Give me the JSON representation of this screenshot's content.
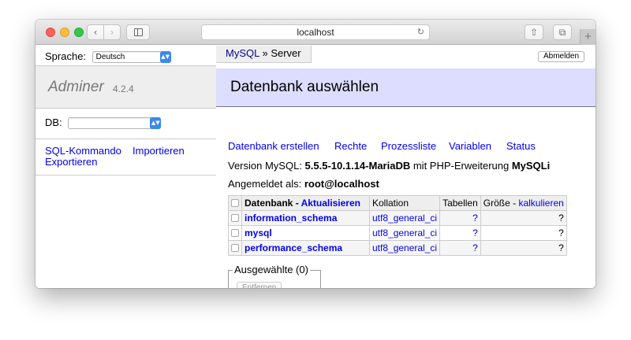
{
  "browser": {
    "address": "localhost",
    "back_glyph": "‹",
    "forward_glyph": "›",
    "reload_glyph": "↻",
    "share_glyph": "⇧",
    "tabs_glyph": "⧉",
    "newtab_glyph": "+"
  },
  "sidebar": {
    "language_label": "Sprache:",
    "language_value": "Deutsch",
    "brand_name": "Adminer",
    "brand_version": "4.2.4",
    "db_label": "DB:",
    "db_value": "",
    "links": [
      "SQL-Kommando",
      "Importieren",
      "Exportieren"
    ]
  },
  "header": {
    "breadcrumb_link": "MySQL",
    "breadcrumb_sep": " » ",
    "breadcrumb_current": "Server",
    "logout_label": "Abmelden",
    "title": "Datenbank auswählen"
  },
  "actions": [
    "Datenbank erstellen",
    "Rechte",
    "Prozessliste",
    "Variablen",
    "Status"
  ],
  "info": {
    "version_prefix": "Version MySQL: ",
    "version": "5.5.5-10.1.14-MariaDB",
    "ext_prefix": " mit PHP-Erweiterung ",
    "ext": "MySQLi",
    "login_prefix": "Angemeldet als: ",
    "login_user": "root@localhost"
  },
  "table": {
    "headers": {
      "database": "Datenbank",
      "dash": " - ",
      "refresh": "Aktualisieren",
      "collation": "Kollation",
      "tables": "Tabellen",
      "size": "Größe",
      "calculate": "kalkulieren"
    },
    "rows": [
      {
        "name": "information_schema",
        "collation": "utf8_general_ci",
        "tables": "?",
        "size": "?"
      },
      {
        "name": "mysql",
        "collation": "utf8_general_ci",
        "tables": "?",
        "size": "?"
      },
      {
        "name": "performance_schema",
        "collation": "utf8_general_ci",
        "tables": "?",
        "size": "?"
      }
    ]
  },
  "selected": {
    "legend": "Ausgewählte (0)",
    "delete_label": "Entfernen"
  },
  "colors": {
    "heading_band": "#ddddff",
    "link": "#0000ee",
    "select_arrow": "#3a8ae8"
  }
}
